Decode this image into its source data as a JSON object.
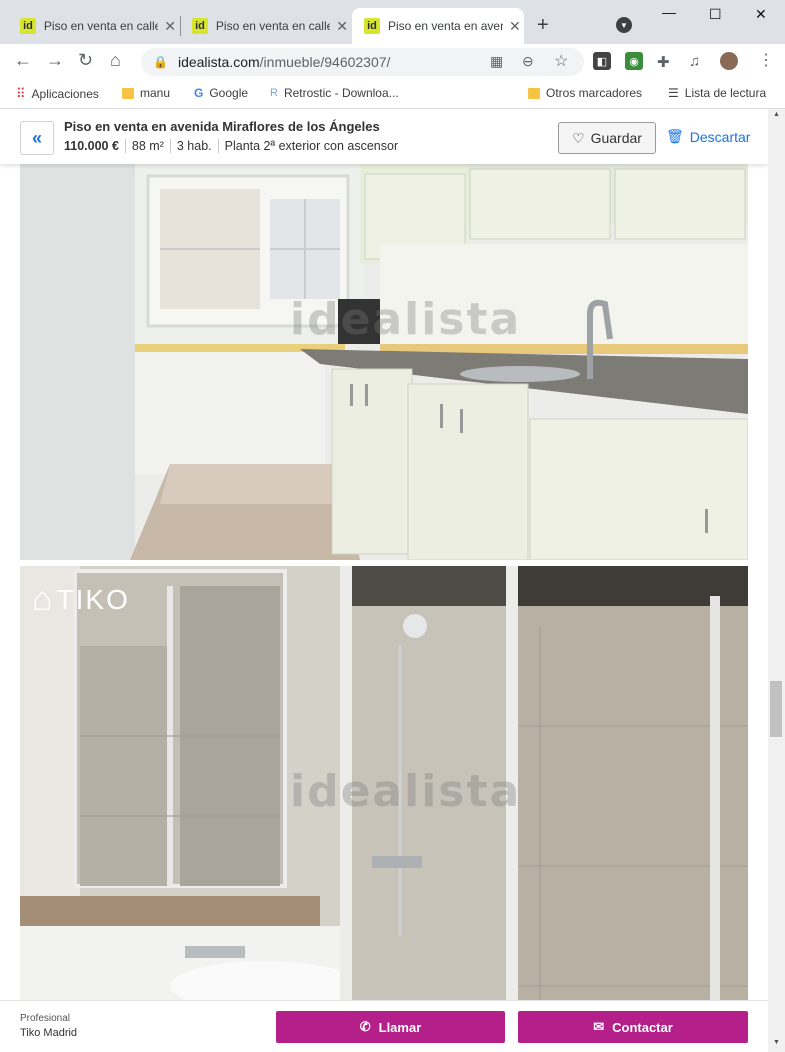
{
  "browser": {
    "tabs": [
      {
        "favicon": "id",
        "title": "Piso en venta en calle",
        "active": false
      },
      {
        "favicon": "id",
        "title": "Piso en venta en calle",
        "active": false
      },
      {
        "favicon": "id",
        "title": "Piso en venta en avenida",
        "active": true
      }
    ],
    "url_domain": "idealista.com",
    "url_path": "/inmueble/94602307/",
    "bookmarks": {
      "apps": "Aplicaciones",
      "manu": "manu",
      "google": "Google",
      "retrostic": "Retrostic - Downloa...",
      "other": "Otros marcadores",
      "reading_list": "Lista de lectura"
    }
  },
  "listing": {
    "title": "Piso en venta en avenida Miraflores de los Ángeles",
    "price": "110.000 €",
    "area": "88 m²",
    "rooms": "3 hab.",
    "floor": "Planta 2ª exterior con ascensor",
    "save_label": "Guardar",
    "discard_label": "Descartar"
  },
  "photos": {
    "watermark": "idealista",
    "logo_text": "TIKO"
  },
  "footer": {
    "role": "Profesional",
    "agency": "Tiko Madrid",
    "call_label": "Llamar",
    "contact_label": "Contactar"
  },
  "colors": {
    "accent": "#b41f89",
    "link": "#1a73e8",
    "favicon": "#d7e530"
  }
}
